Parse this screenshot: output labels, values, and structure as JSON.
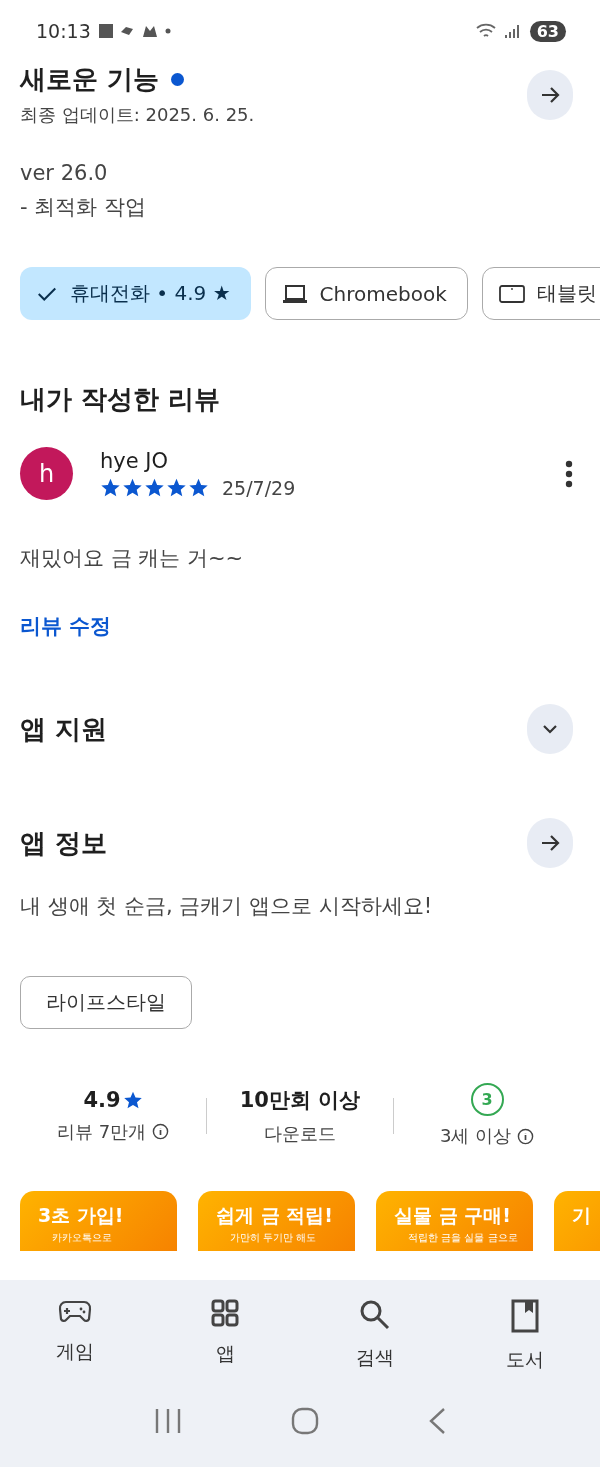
{
  "status_bar": {
    "time": "10:13",
    "battery": "63"
  },
  "whats_new": {
    "title": "새로운 기능",
    "unread": true,
    "updated": "최종 업데이트: 2025. 6. 25.",
    "lines": [
      "ver 26.0",
      "- 최적화 작업"
    ]
  },
  "devices": [
    {
      "kind": "phone",
      "label": "휴대전화 • 4.9 ★",
      "selected": true
    },
    {
      "kind": "laptop",
      "label": "Chromebook",
      "selected": false
    },
    {
      "kind": "tablet",
      "label": "태블릿",
      "selected": false
    }
  ],
  "my_review": {
    "heading": "내가 작성한 리뷰",
    "avatar": "h",
    "author": "hye JO",
    "stars": 5,
    "date": "25/7/29",
    "text": "재밌어요 금 캐는 거~~",
    "edit_link": "리뷰 수정"
  },
  "app_support": {
    "title": "앱 지원",
    "expanded": false
  },
  "about": {
    "title": "앱 정보",
    "description": "내 생애 첫 순금, 금캐기 앱으로 시작하세요!",
    "category": "라이프스타일"
  },
  "stats": [
    {
      "kind": "rating",
      "value": "4.9",
      "label": "리뷰 7만개"
    },
    {
      "kind": "plain",
      "value": "10만회 이상",
      "label": "다운로드"
    },
    {
      "kind": "age",
      "value": "3",
      "label": "3세 이상"
    }
  ],
  "screenshots": [
    {
      "title": "3초 가입!",
      "subtitle": "카카오톡으로"
    },
    {
      "title": "쉽게 금 적립!",
      "subtitle": "가만히 두기만 해도"
    },
    {
      "title": "실물 금 구매!",
      "subtitle": "적립한 금을 실물 금으로"
    },
    {
      "title": "기"
    }
  ],
  "bottom_nav": [
    {
      "kind": "games",
      "label": "게임",
      "selected": false
    },
    {
      "kind": "apps",
      "label": "앱",
      "selected": false
    },
    {
      "kind": "search",
      "label": "검색",
      "selected": false
    },
    {
      "kind": "books",
      "label": "도서",
      "selected": false
    }
  ]
}
